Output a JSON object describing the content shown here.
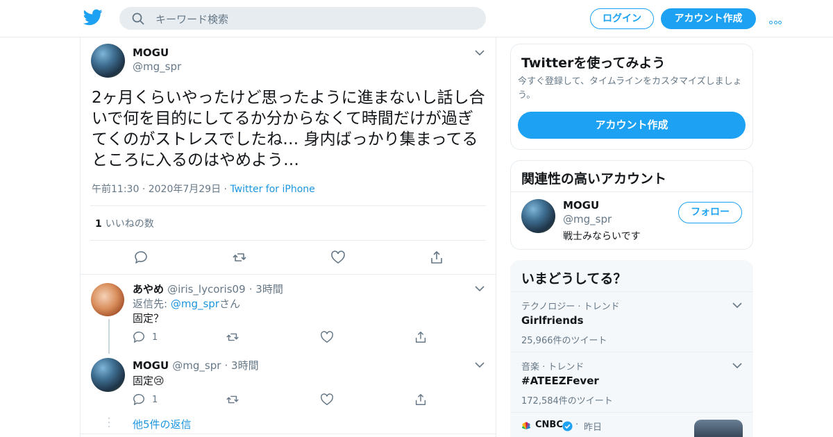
{
  "header": {
    "search_placeholder": "キーワード検索",
    "login_label": "ログイン",
    "create_account_label": "アカウント作成",
    "brand_color": "#1da1f2"
  },
  "main_tweet": {
    "name": "MOGU",
    "handle": "@mg_spr",
    "text": "2ヶ月くらいやったけど思ったように進まないし話し合いで何を目的にしてるか分からなくて時間だけが過ぎてくのがストレスでしたね… 身内ばっかり集まってるところに入るのはやめよう…",
    "time": "午前11:30",
    "date": "2020年7月29日",
    "source": "Twitter for iPhone",
    "likes_count": "1",
    "likes_label": "いいねの数"
  },
  "replies": [
    {
      "name": "あやめ",
      "handle": "@iris_lycoris09",
      "time": "3時間",
      "reply_to_prefix": "返信先: ",
      "reply_to_handle": "@mg_spr",
      "reply_to_suffix": "さん",
      "text": "固定？",
      "reply_count": "1"
    },
    {
      "name": "MOGU",
      "handle": "@mg_spr",
      "time": "3時間",
      "text": "固定😢",
      "reply_count": "1"
    }
  ],
  "more_replies_label": "他5件の返信",
  "sidebar": {
    "signup_card": {
      "title": "Twitterを使ってみよう",
      "subtitle": "今すぐ登録して、タイムラインをカスタマイズしましょう。",
      "button_label": "アカウント作成"
    },
    "related_card": {
      "title": "関連性の高いアカウント",
      "name": "MOGU",
      "handle": "@mg_spr",
      "bio": "戦士みならいです",
      "follow_label": "フォロー"
    },
    "trends_card": {
      "title": "いまどうしてる？",
      "items": [
        {
          "category": "テクノロジー · トレンド",
          "name": "Girlfriends",
          "count": "25,966件のツイート"
        },
        {
          "category": "音楽 · トレンド",
          "name": "#ATEEZFever",
          "count": "172,584件のツイート"
        }
      ],
      "news": {
        "source": "CNBC",
        "time": "昨日"
      }
    }
  }
}
